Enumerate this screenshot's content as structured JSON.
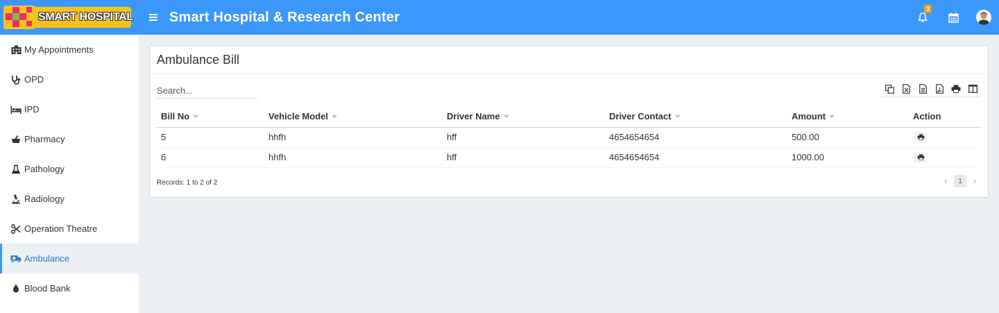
{
  "header": {
    "logo_text": "SMART HOSPITAL",
    "title": "Smart Hospital & Research Center",
    "notification_count": "3",
    "accent_color": "#3c97fb",
    "logo_color": "#f7c31b"
  },
  "sidebar": {
    "active": "Ambulance",
    "items": [
      {
        "label": "My Appointments",
        "icon": "hospital-building-icon"
      },
      {
        "label": "OPD",
        "icon": "stethoscope-icon"
      },
      {
        "label": "IPD",
        "icon": "bed-icon"
      },
      {
        "label": "Pharmacy",
        "icon": "mortar-pestle-icon"
      },
      {
        "label": "Pathology",
        "icon": "flask-icon"
      },
      {
        "label": "Radiology",
        "icon": "microscope-icon"
      },
      {
        "label": "Operation Theatre",
        "icon": "scissors-icon"
      },
      {
        "label": "Ambulance",
        "icon": "ambulance-icon"
      },
      {
        "label": "Blood Bank",
        "icon": "blood-drop-icon"
      }
    ]
  },
  "main": {
    "title": "Ambulance Bill",
    "search_placeholder": "Search...",
    "columns": [
      "Bill No",
      "Vehicle Model",
      "Driver Name",
      "Driver Contact",
      "Amount",
      "Action"
    ],
    "rows": [
      {
        "bill_no": "5",
        "vehicle_model": "hhfh",
        "driver_name": "hff",
        "driver_contact": "4654654654",
        "amount": "500.00"
      },
      {
        "bill_no": "6",
        "vehicle_model": "hhfh",
        "driver_name": "hff",
        "driver_contact": "4654654654",
        "amount": "1000.00"
      }
    ],
    "records_text": "Records: 1 to 2 of 2",
    "pagination": {
      "prev": "‹",
      "current": "1",
      "next": "›"
    }
  }
}
